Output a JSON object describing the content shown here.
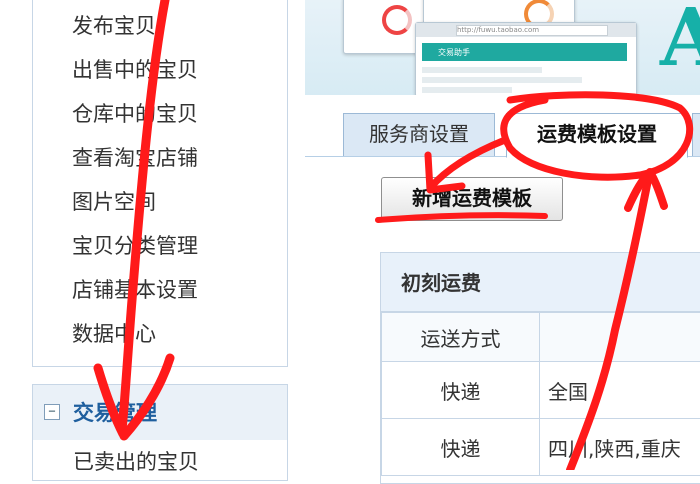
{
  "sidebar": {
    "items": [
      {
        "label": "发布宝贝"
      },
      {
        "label": "出售中的宝贝"
      },
      {
        "label": "仓库中的宝贝"
      },
      {
        "label": "查看淘宝店铺"
      },
      {
        "label": "图片空间"
      },
      {
        "label": "宝贝分类管理"
      },
      {
        "label": "店铺基本设置"
      },
      {
        "label": "数据中心"
      }
    ],
    "section": {
      "toggle": "−",
      "title": "交易管理",
      "first_item": "已卖出的宝贝"
    }
  },
  "banner": {
    "brand_glyph": "A",
    "address_text": "http://fuwu.taobao.com",
    "app_name": "交易助手"
  },
  "tabs": {
    "service_provider": "服务商设置",
    "shipping_template": "运费模板设置"
  },
  "new_template_button": "新增运费模板",
  "template": {
    "name": "初刻运费",
    "header": {
      "method": "运送方式",
      "area": ""
    },
    "rows": [
      {
        "method": "快递",
        "area": "全国"
      },
      {
        "method": "快递",
        "area": "四川,陕西,重庆"
      }
    ]
  },
  "colors": {
    "annotation": "#ff1a1a",
    "accent": "#1f5f9e",
    "brand": "#16b0a8"
  }
}
